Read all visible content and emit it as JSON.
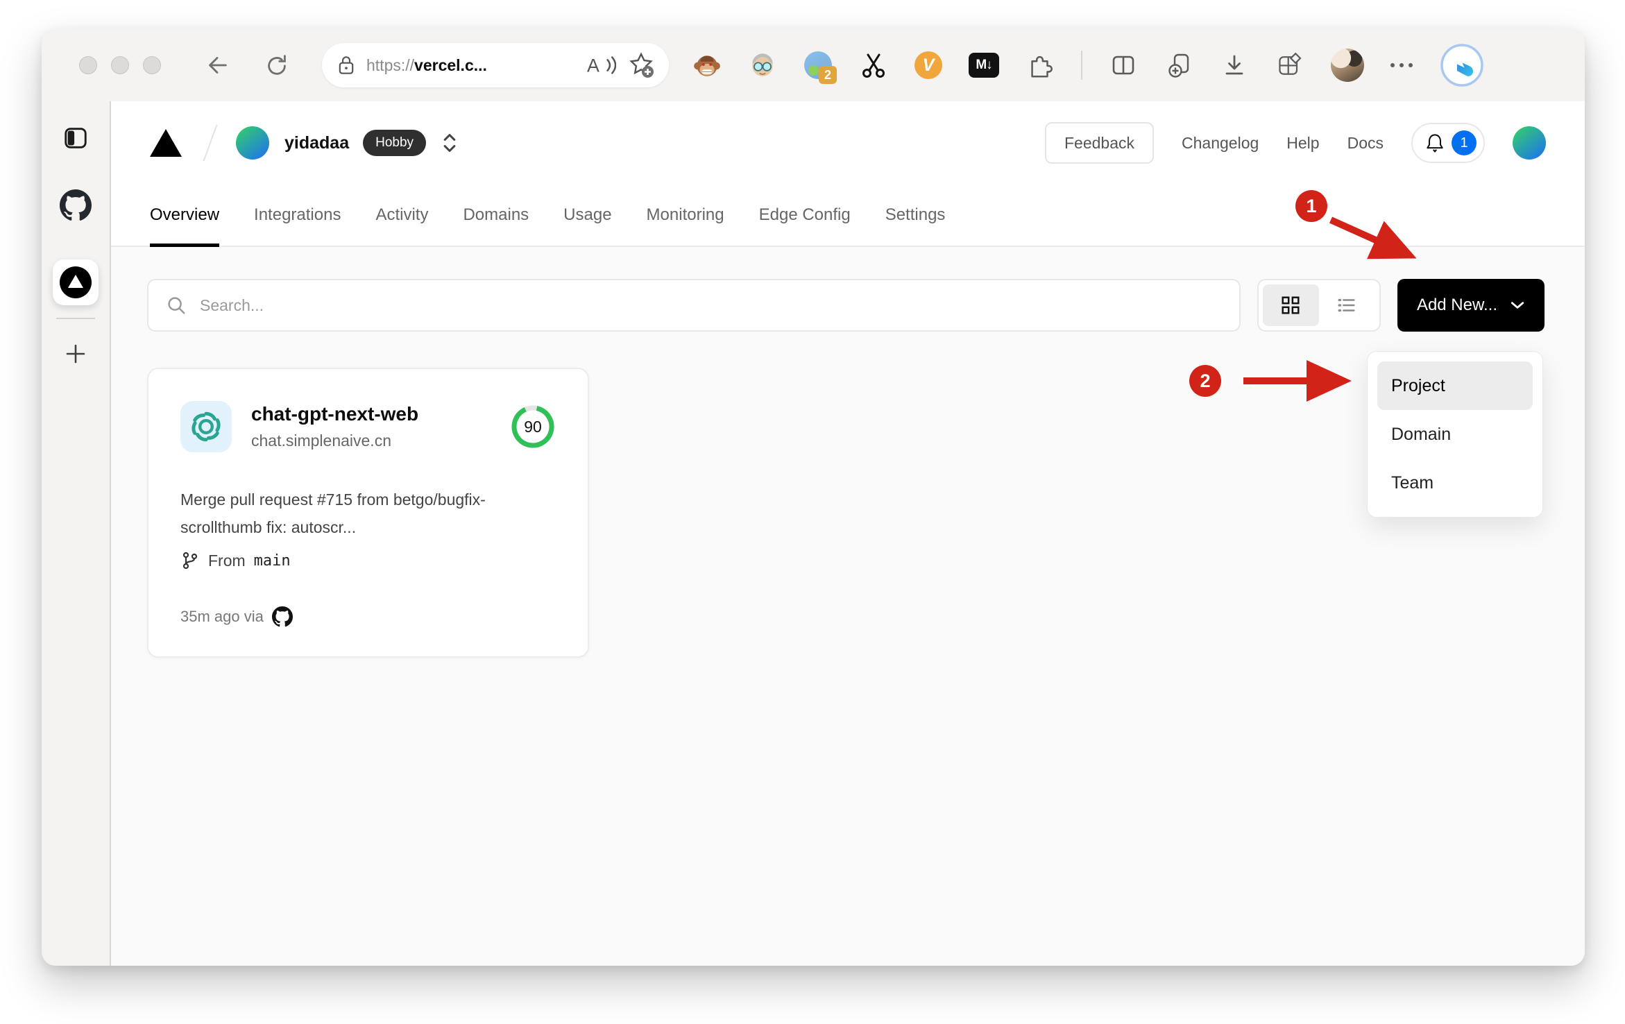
{
  "colors": {
    "annotation_red": "#d12317",
    "score_green": "#2fc158",
    "notification_blue": "#0070f3",
    "accent_black": "#000000"
  },
  "browser": {
    "address": {
      "protocol": "https://",
      "host": "vercel.c..."
    },
    "extensions": {
      "badge_count": "2",
      "markdown_label": "M↓",
      "v_label": "V"
    }
  },
  "site": {
    "team": {
      "name": "yidadaa",
      "plan": "Hobby"
    },
    "header_links": {
      "feedback": "Feedback",
      "changelog": "Changelog",
      "help": "Help",
      "docs": "Docs"
    },
    "notification_count": "1",
    "tabs": [
      "Overview",
      "Integrations",
      "Activity",
      "Domains",
      "Usage",
      "Monitoring",
      "Edge Config",
      "Settings"
    ],
    "toolbar": {
      "search_placeholder": "Search...",
      "add_new_label": "Add New..."
    },
    "dropdown": {
      "items": [
        "Project",
        "Domain",
        "Team"
      ]
    },
    "project_card": {
      "name": "chat-gpt-next-web",
      "domain": "chat.simplenaive.cn",
      "score": "90",
      "commit_message": "Merge pull request #715 from betgo/bugfix-scrollthumb fix: autoscr...",
      "branch_label": "From",
      "branch_name": "main",
      "deploy_meta": "35m ago via"
    }
  },
  "annotations": {
    "step1": "1",
    "step2": "2"
  }
}
